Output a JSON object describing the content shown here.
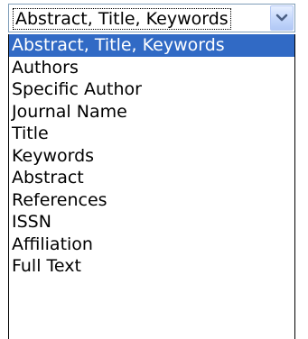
{
  "select": {
    "value": "Abstract, Title, Keywords",
    "arrow_icon": "chevron-down-icon"
  },
  "options": [
    {
      "label": "Abstract, Title, Keywords",
      "selected": true
    },
    {
      "label": "Authors",
      "selected": false
    },
    {
      "label": "Specific Author",
      "selected": false
    },
    {
      "label": "Journal Name",
      "selected": false
    },
    {
      "label": "Title",
      "selected": false
    },
    {
      "label": "Keywords",
      "selected": false
    },
    {
      "label": "Abstract",
      "selected": false
    },
    {
      "label": "References",
      "selected": false
    },
    {
      "label": "ISSN",
      "selected": false
    },
    {
      "label": "Affiliation",
      "selected": false
    },
    {
      "label": "Full Text",
      "selected": false
    }
  ],
  "colors": {
    "highlight": "#316ac5",
    "border": "#7f9db9"
  }
}
